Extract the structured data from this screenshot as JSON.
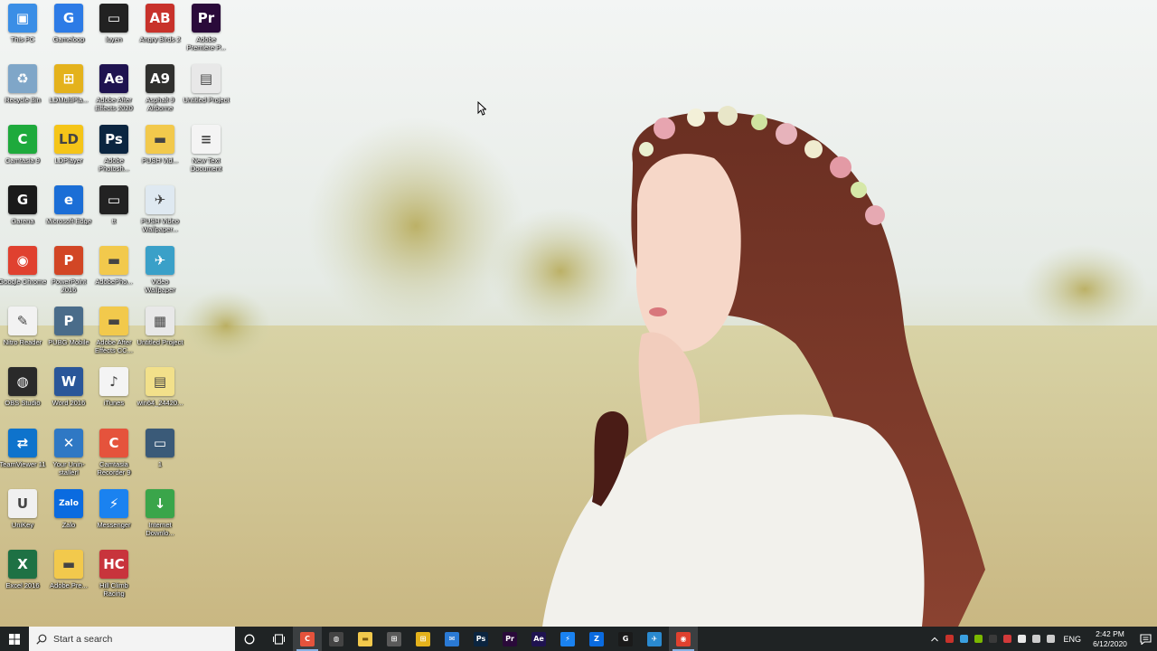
{
  "desktop": {
    "icons": [
      {
        "label": "This PC",
        "icon": "computer-icon",
        "color": "#3a8ee6",
        "glyph": "▣"
      },
      {
        "label": "Gameloop",
        "icon": "gameloop-icon",
        "color": "#2d7be6",
        "glyph": "G"
      },
      {
        "label": "luyen",
        "icon": "video-file-icon",
        "color": "#222222",
        "glyph": "▭"
      },
      {
        "label": "Angry Birds 2",
        "icon": "angry-birds-icon",
        "color": "#c8322b",
        "glyph": "AB"
      },
      {
        "label": "Adobe Premiere P...",
        "icon": "premiere-icon",
        "color": "#2a0a3a",
        "glyph": "Pr"
      },
      {
        "label": "Recycle Bin",
        "icon": "recycle-bin-icon",
        "color": "#7fa6c8",
        "glyph": "♻"
      },
      {
        "label": "LDMultiPla...",
        "icon": "ldmultiplayer-icon",
        "color": "#e4b21c",
        "glyph": "⊞"
      },
      {
        "label": "Adobe After Effects 2020",
        "icon": "after-effects-icon",
        "color": "#1f1350",
        "glyph": "Ae"
      },
      {
        "label": "Asphalt 9 Airborne",
        "icon": "asphalt-icon",
        "color": "#30302e",
        "glyph": "A9"
      },
      {
        "label": "Untitled Project",
        "icon": "video-project-icon",
        "color": "#e8e8e8",
        "glyph": "▤"
      },
      {
        "label": "Camtasia 9",
        "icon": "camtasia-icon",
        "color": "#1eaa3c",
        "glyph": "C"
      },
      {
        "label": "LDPlayer",
        "icon": "ldplayer-icon",
        "color": "#f5c518",
        "glyph": "LD"
      },
      {
        "label": "Adobe Photosh...",
        "icon": "photoshop-icon",
        "color": "#0b2540",
        "glyph": "Ps"
      },
      {
        "label": "PUSH Vid...",
        "icon": "folder-icon",
        "color": "#f2c94c",
        "glyph": "▬"
      },
      {
        "label": "New Text Document",
        "icon": "text-document-icon",
        "color": "#f4f4f4",
        "glyph": "≡"
      },
      {
        "label": "Garena",
        "icon": "garena-icon",
        "color": "#1a1a1a",
        "glyph": "G"
      },
      {
        "label": "Microsoft Edge",
        "icon": "edge-icon",
        "color": "#1b6ed6",
        "glyph": "e"
      },
      {
        "label": "tt",
        "icon": "video-file-icon",
        "color": "#222222",
        "glyph": "▭"
      },
      {
        "label": "PUSH Video Wallpaper...",
        "icon": "push-wallpaper-icon",
        "color": "#dfe9f1",
        "glyph": "✈"
      },
      {
        "label": "Google Chrome",
        "icon": "chrome-icon",
        "color": "#e0412f",
        "glyph": "◉"
      },
      {
        "label": "PowerPoint 2016",
        "icon": "powerpoint-icon",
        "color": "#d24625",
        "glyph": "P"
      },
      {
        "label": "AdobePho...",
        "icon": "folder-icon",
        "color": "#f2c94c",
        "glyph": "▬"
      },
      {
        "label": "Video Wallpaper",
        "icon": "video-wallpaper-icon",
        "color": "#3aa0c8",
        "glyph": "✈"
      },
      {
        "label": "Nitro Reader",
        "icon": "nitro-icon",
        "color": "#f2f2f2",
        "glyph": "✎"
      },
      {
        "label": "PUBG Mobile",
        "icon": "pubg-icon",
        "color": "#4a6c8a",
        "glyph": "P"
      },
      {
        "label": "Adobe After Effects CC...",
        "icon": "folder-icon",
        "color": "#f2c94c",
        "glyph": "▬"
      },
      {
        "label": "Untitled Project",
        "icon": "camtasia-project-icon",
        "color": "#e8e8e8",
        "glyph": "▦"
      },
      {
        "label": "OBS Studio",
        "icon": "obs-icon",
        "color": "#2a2a2a",
        "glyph": "◍"
      },
      {
        "label": "Word 2016",
        "icon": "word-icon",
        "color": "#2a5699",
        "glyph": "W"
      },
      {
        "label": "iTunes",
        "icon": "itunes-icon",
        "color": "#f4f4f4",
        "glyph": "♪"
      },
      {
        "label": "win64_24420...",
        "icon": "archive-icon",
        "color": "#f2e08a",
        "glyph": "▤"
      },
      {
        "label": "TeamViewer 11",
        "icon": "teamviewer-icon",
        "color": "#0e73cc",
        "glyph": "⇄"
      },
      {
        "label": "Your Unin-staller!",
        "icon": "uninstaller-icon",
        "color": "#2f78c4",
        "glyph": "✕"
      },
      {
        "label": "Camtasia Recorder 9",
        "icon": "camtasia-recorder-icon",
        "color": "#e5533c",
        "glyph": "C"
      },
      {
        "label": "1",
        "icon": "video-file-icon",
        "color": "#3a5a78",
        "glyph": "▭"
      },
      {
        "label": "UniKey",
        "icon": "unikey-icon",
        "color": "#f0f0f0",
        "glyph": "U"
      },
      {
        "label": "Zalo",
        "icon": "zalo-icon",
        "color": "#0a6be0",
        "glyph": "Zalo"
      },
      {
        "label": "Messenger",
        "icon": "messenger-icon",
        "color": "#1a82f0",
        "glyph": "⚡"
      },
      {
        "label": "Internet Downlo...",
        "icon": "idm-icon",
        "color": "#3aa54a",
        "glyph": "↓"
      },
      {
        "label": "Excel 2016",
        "icon": "excel-icon",
        "color": "#1e7144",
        "glyph": "X"
      },
      {
        "label": "Adobe.Pre...",
        "icon": "folder-icon",
        "color": "#f2c94c",
        "glyph": "▬"
      },
      {
        "label": "Hill Climb Racing",
        "icon": "hill-climb-icon",
        "color": "#c8343c",
        "glyph": "HC"
      }
    ]
  },
  "taskbar": {
    "search_placeholder": "Start a search",
    "apps": [
      {
        "name": "camtasia",
        "icon": "camtasia-icon",
        "color": "#e5533c",
        "glyph": "C",
        "active": true,
        "highlight": true
      },
      {
        "name": "obs",
        "icon": "obs-icon",
        "color": "#444444",
        "glyph": "◍",
        "active": false,
        "highlight": false
      },
      {
        "name": "file-explorer",
        "icon": "folder-icon",
        "color": "#f2c94c",
        "glyph": "▬",
        "active": false,
        "highlight": false
      },
      {
        "name": "store",
        "icon": "store-icon",
        "color": "#5a5a5a",
        "glyph": "⊞",
        "active": false,
        "highlight": false
      },
      {
        "name": "ldmultiplayer",
        "icon": "ldmultiplayer-icon",
        "color": "#e4b21c",
        "glyph": "⊞",
        "active": false,
        "highlight": false
      },
      {
        "name": "mail",
        "icon": "mail-icon",
        "color": "#2a7ad5",
        "glyph": "✉",
        "active": false,
        "highlight": false
      },
      {
        "name": "photoshop",
        "icon": "photoshop-icon",
        "color": "#0b2540",
        "glyph": "Ps",
        "active": false,
        "highlight": false
      },
      {
        "name": "premiere",
        "icon": "premiere-icon",
        "color": "#2a0a3a",
        "glyph": "Pr",
        "active": false,
        "highlight": false
      },
      {
        "name": "after-effects",
        "icon": "after-effects-icon",
        "color": "#1f1350",
        "glyph": "Ae",
        "active": false,
        "highlight": false
      },
      {
        "name": "messenger",
        "icon": "messenger-icon",
        "color": "#1a82f0",
        "glyph": "⚡",
        "active": false,
        "highlight": false
      },
      {
        "name": "zalo",
        "icon": "zalo-icon",
        "color": "#0a6be0",
        "glyph": "Z",
        "active": false,
        "highlight": false
      },
      {
        "name": "garena",
        "icon": "garena-icon",
        "color": "#1a1a1a",
        "glyph": "G",
        "active": false,
        "highlight": false
      },
      {
        "name": "push-wallpaper",
        "icon": "push-wallpaper-icon",
        "color": "#2a8ad0",
        "glyph": "✈",
        "active": false,
        "highlight": false
      },
      {
        "name": "chrome",
        "icon": "chrome-icon",
        "color": "#e0412f",
        "glyph": "◉",
        "active": true,
        "highlight": true
      }
    ],
    "tray_icons": [
      {
        "name": "garena-tray-icon",
        "color": "#c8322b"
      },
      {
        "name": "push-tray-icon",
        "color": "#3aa0e0"
      },
      {
        "name": "nvidia-tray-icon",
        "color": "#7ab800"
      },
      {
        "name": "security-tray-icon",
        "color": "#3a3a3a"
      },
      {
        "name": "antivirus-tray-icon",
        "color": "#d23a3a"
      },
      {
        "name": "unikey-tray-icon",
        "color": "#e8e8e8"
      },
      {
        "name": "network-tray-icon",
        "color": "#cccccc"
      },
      {
        "name": "volume-tray-icon",
        "color": "#cccccc"
      }
    ],
    "language": "ENG",
    "time": "2:42 PM",
    "date": "6/12/2020"
  }
}
